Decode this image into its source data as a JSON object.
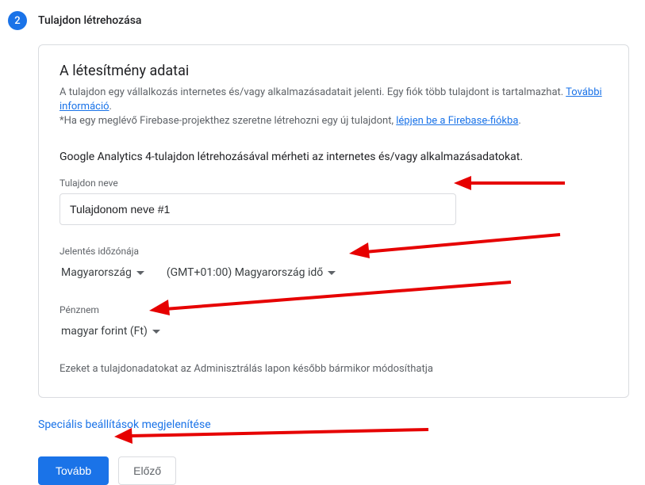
{
  "step": {
    "number": "2",
    "title": "Tulajdon létrehozása"
  },
  "card": {
    "title": "A létesítmény adatai",
    "desc_part1": "A tulajdon egy vállalkozás internetes és/vagy alkalmazásadatait jelenti. Egy fiók több tulajdont is tartalmazhat. ",
    "link_more": "További információ",
    "desc_part2": ".",
    "desc_line2_part1": "*Ha egy meglévő Firebase-projekthez szeretne létrehozni egy új tulajdont, ",
    "link_firebase": "lépjen be a Firebase-fiókba",
    "desc_line2_part2": ".",
    "section_intro": "Google Analytics 4-tulajdon létrehozásával mérheti az internetes és/vagy alkalmazásadatokat.",
    "property_name_label": "Tulajdon neve",
    "property_name_value": "Tulajdonom neve #1",
    "timezone_label": "Jelentés időzónája",
    "timezone_country": "Magyarország",
    "timezone_value": "(GMT+01:00) Magyarország idő",
    "currency_label": "Pénznem",
    "currency_value": "magyar forint (Ft)",
    "note": "Ezeket a tulajdonadatokat az Adminisztrálás lapon később bármikor módosíthatja"
  },
  "advanced_link": "Speciális beállítások megjelenítése",
  "buttons": {
    "next": "Tovább",
    "prev": "Előző"
  }
}
